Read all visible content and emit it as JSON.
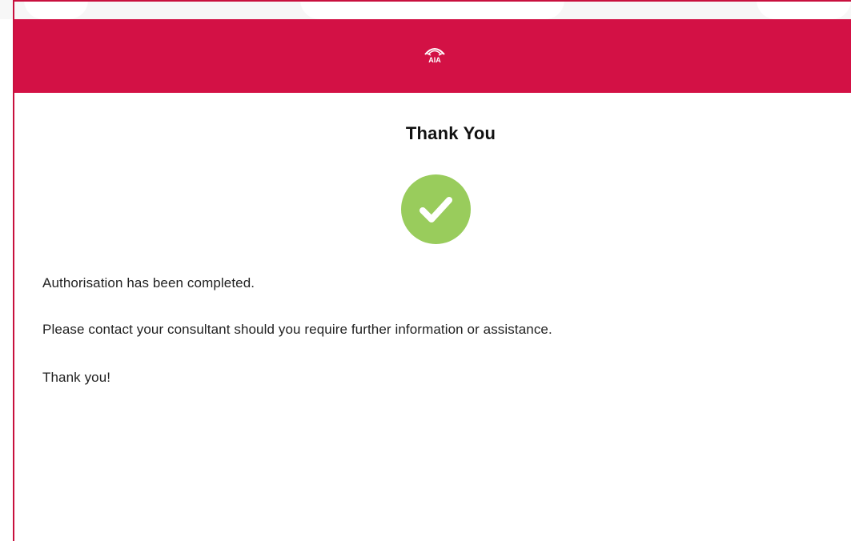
{
  "header": {
    "brand_color": "#d31145",
    "logo_icon": "aia-logo-icon",
    "logo_text": "AIA"
  },
  "main": {
    "title": "Thank You",
    "status_icon": "check-circle-icon",
    "status_color": "#99cc5c",
    "messages": [
      "Authorisation has been completed.",
      "Please contact your consultant should you require further information or assistance.",
      "Thank you!"
    ]
  }
}
